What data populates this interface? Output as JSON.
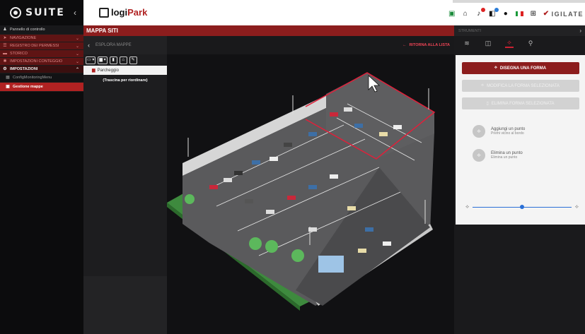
{
  "brand": {
    "name": "SUITE",
    "collapse_icon": "chevron-left-icon"
  },
  "sidebar": {
    "items": [
      {
        "label": "Pannello di controllo",
        "icon": "dashboard-icon"
      },
      {
        "label": "NAVIGAZIONE",
        "icon": "navigation-icon"
      },
      {
        "label": "REGISTRO DEI PERMESSI",
        "icon": "list-icon"
      },
      {
        "label": "STORICO",
        "icon": "car-icon"
      },
      {
        "label": "IMPOSTAZIONI CONTEGGIO",
        "icon": "counter-icon"
      },
      {
        "label": "IMPOSTAZIONI",
        "icon": "settings-icon"
      },
      {
        "label": "ConfigMonitoringMenu",
        "icon": "config-icon"
      },
      {
        "label": "Gestione mappe",
        "icon": "map-icon"
      }
    ]
  },
  "header": {
    "app_name_prefix": "logi",
    "app_name_suffix": "Park",
    "partner": "IGILATE"
  },
  "page": {
    "title": "MAPPA SITI"
  },
  "explorer": {
    "title": "ESPLORA MAPPE",
    "node": "Parcheggio",
    "hint": "(Trascina per riordinare)"
  },
  "canvas": {
    "return_label": "RITORNA ALLA LISTA"
  },
  "tools": {
    "title": "STRUMENTI",
    "draw_label": "DISEGNA UNA FORMA",
    "modify_label": "MODIFICA LA FORMA SELEZIONATA",
    "delete_label": "ELIMINA FORMA SELEZIONATA",
    "add_point_title": "Aggiungi un punto",
    "add_point_sub": "Premi vicino al bordo",
    "remove_point_title": "Elimina un punto",
    "remove_point_sub": "Elimina un punto",
    "slider_value": 0.5
  },
  "colors": {
    "accent": "#8c1d1d",
    "active": "#b02222",
    "selection": "#e0203a"
  }
}
